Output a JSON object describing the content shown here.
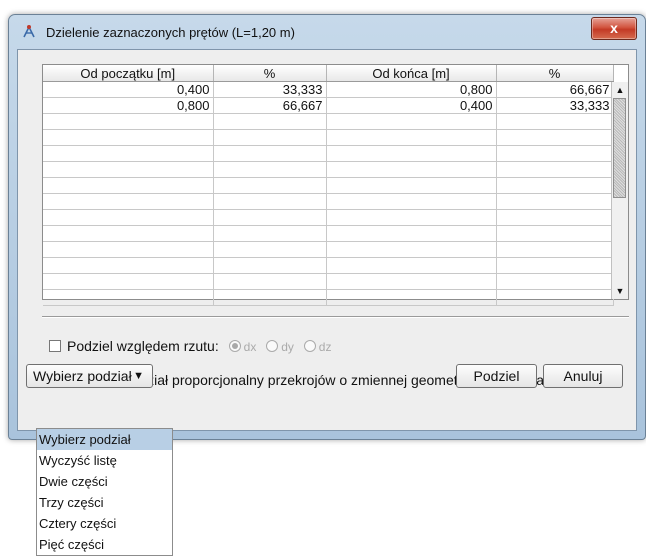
{
  "window": {
    "title": "Dzielenie zaznaczonych prętów (L=1,20 m)",
    "close_label": "x"
  },
  "table": {
    "columns": [
      "Od początku [m]",
      "%",
      "Od końca [m]",
      "%"
    ],
    "rows": [
      [
        "0,400",
        "33,333",
        "0,800",
        "66,667"
      ],
      [
        "0,800",
        "66,667",
        "0,400",
        "33,333"
      ]
    ]
  },
  "options": {
    "split_by_projection": {
      "label": "Podziel względem rzutu:",
      "checked": false,
      "choices": [
        "dx",
        "dy",
        "dz"
      ],
      "selected": "dx"
    },
    "proportional": {
      "label": "Zastosuj podział proporcjonalny przekrojów o zmiennej geometrii przy podziale pręta",
      "checked": true
    }
  },
  "footer": {
    "dropdown_label": "Wybierz podział",
    "split_button": "Podziel",
    "cancel_button": "Anuluj"
  },
  "dropdown_menu": {
    "items": [
      "Wybierz podział",
      "Wyczyść listę",
      "Dwie części",
      "Trzy części",
      "Cztery części",
      "Pięć części"
    ],
    "selected_index": 0
  }
}
